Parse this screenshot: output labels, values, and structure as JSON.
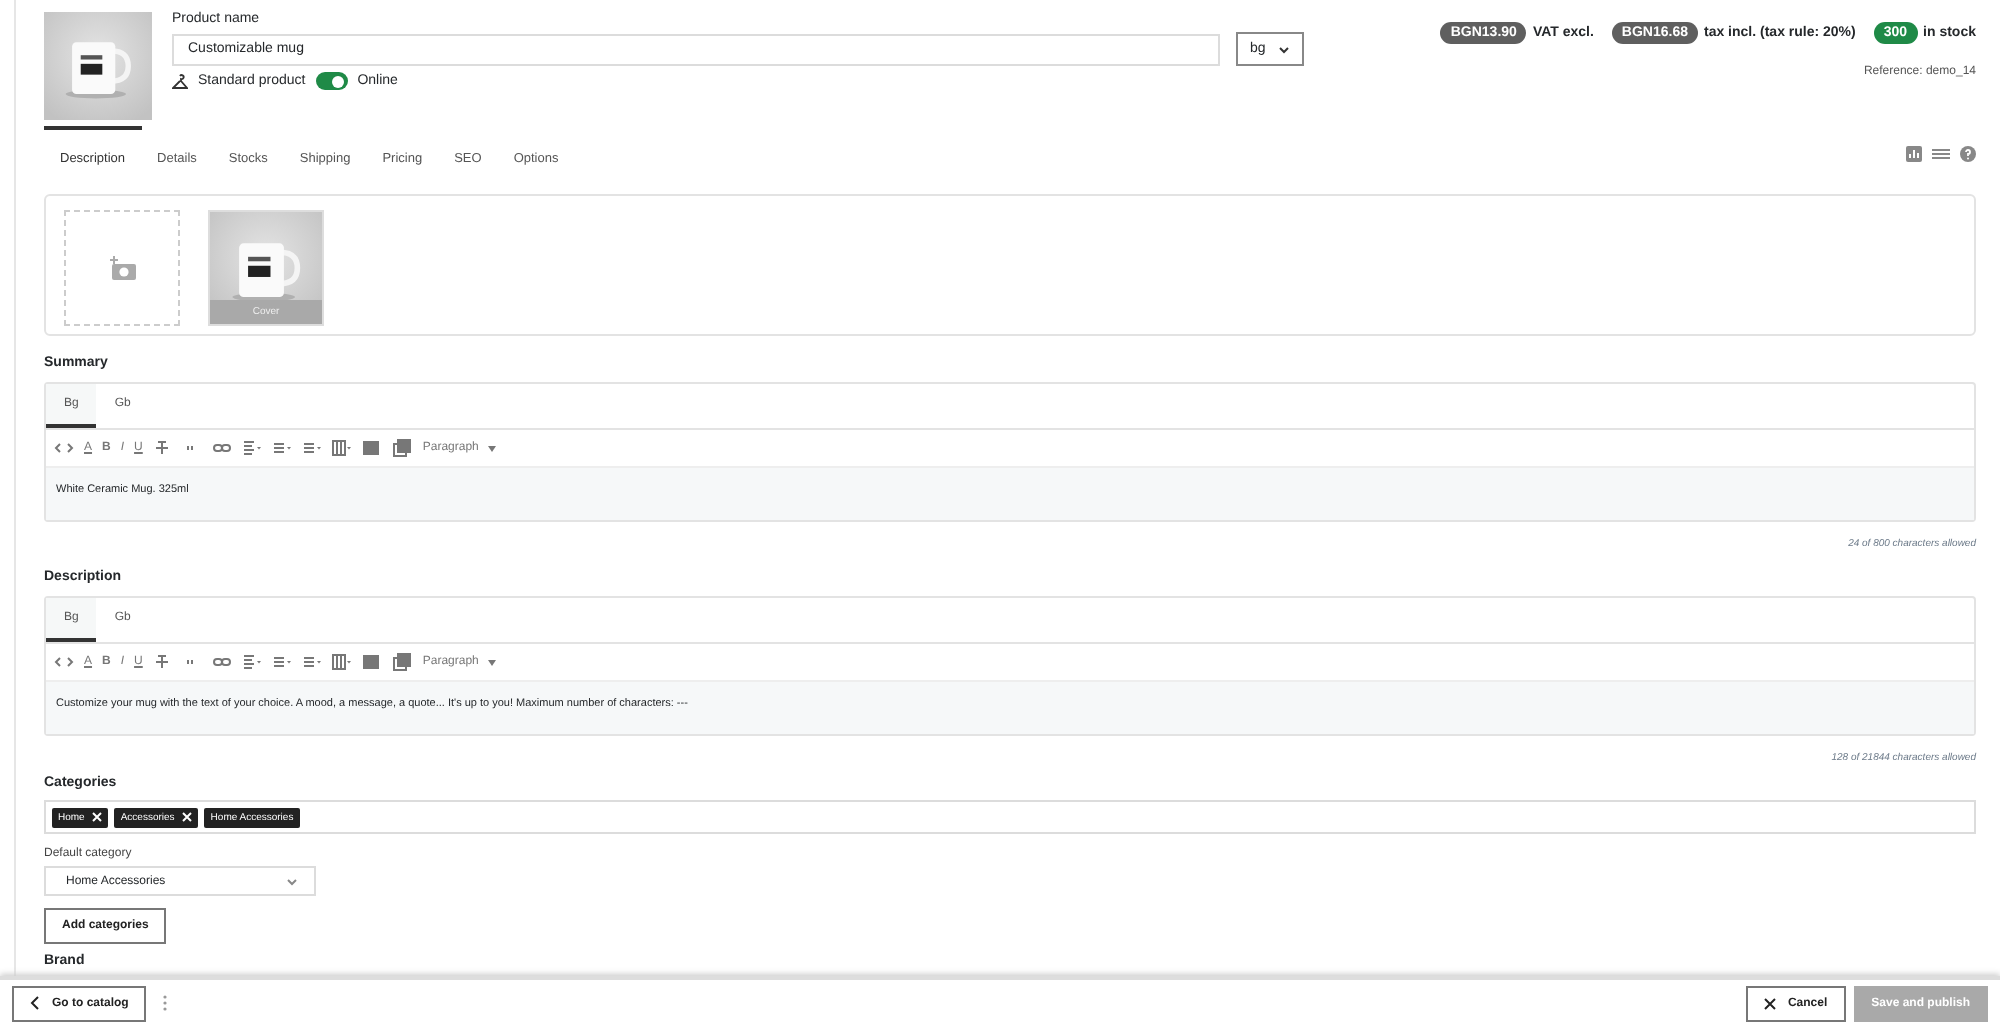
{
  "product": {
    "name_label": "Product name",
    "name_value": "Customizable mug",
    "language": "bg",
    "type_label": "Standard product",
    "online": true,
    "online_label": "Online"
  },
  "badges": [
    {
      "value": "BGN13.90",
      "label": "VAT excl.",
      "color": "#5f5f5f"
    },
    {
      "value": "BGN16.68",
      "label": "tax incl. (tax rule: 20%)",
      "color": "#5f5f5f"
    },
    {
      "value": "300",
      "label": "in stock",
      "color": "#1f8a47"
    }
  ],
  "reference": "Reference: demo_14",
  "tabs": [
    {
      "label": "Description",
      "selected": true
    },
    {
      "label": "Details",
      "selected": false
    },
    {
      "label": "Stocks",
      "selected": false
    },
    {
      "label": "Shipping",
      "selected": false
    },
    {
      "label": "Pricing",
      "selected": false
    },
    {
      "label": "SEO",
      "selected": false
    },
    {
      "label": "Options",
      "selected": false
    }
  ],
  "images": {
    "cover_label": "Cover"
  },
  "editors": [
    {
      "title": "Summary",
      "languages": [
        {
          "label": "Bg",
          "selected": true
        },
        {
          "label": "Gb",
          "selected": false
        }
      ],
      "toolbar": {
        "font_color": "A",
        "bold": "B",
        "italic": "I",
        "underline": "U",
        "format": "Paragraph"
      },
      "text": "White Ceramic Mug. 325ml",
      "counter": "24 of 800 characters allowed"
    },
    {
      "title": "Description",
      "languages": [
        {
          "label": "Bg",
          "selected": true
        },
        {
          "label": "Gb",
          "selected": false
        }
      ],
      "toolbar": {
        "font_color": "A",
        "bold": "B",
        "italic": "I",
        "underline": "U",
        "format": "Paragraph"
      },
      "text": "Customize your mug with the text of your choice. A mood, a message, a quote... It's up to you! Maximum number of characters: ---",
      "counter": "128 of 21844 characters allowed"
    }
  ],
  "categories": {
    "title": "Categories",
    "tags": [
      {
        "label": "Home",
        "removable": true
      },
      {
        "label": "Accessories",
        "removable": true
      },
      {
        "label": "Home Accessories",
        "removable": false
      }
    ],
    "default_label": "Default category",
    "default_value": "Home Accessories",
    "add_button": "Add categories"
  },
  "brand_title": "Brand",
  "footer": {
    "back": "Go to catalog",
    "cancel": "Cancel",
    "save": "Save and publish",
    "save_disabled": true
  }
}
